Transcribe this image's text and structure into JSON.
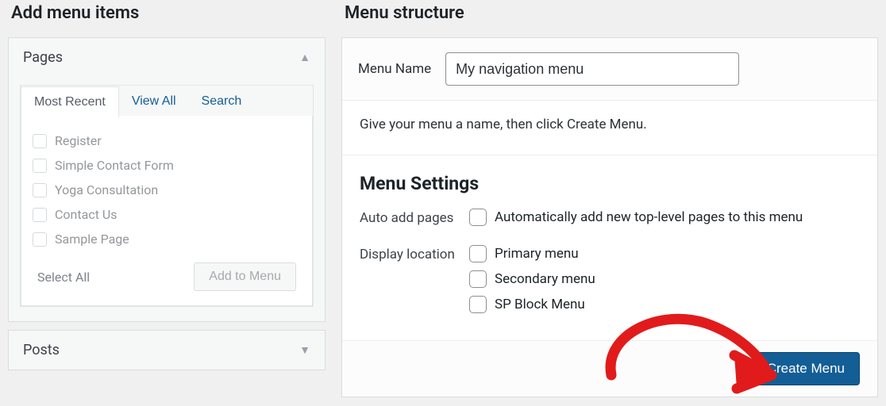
{
  "left": {
    "heading": "Add menu items",
    "panels": {
      "pages": {
        "title": "Pages",
        "tabs": [
          "Most Recent",
          "View All",
          "Search"
        ],
        "items": [
          "Register",
          "Simple Contact Form",
          "Yoga Consultation",
          "Contact Us",
          "Sample Page"
        ],
        "select_all": "Select All",
        "add_button": "Add to Menu"
      },
      "posts": {
        "title": "Posts"
      }
    }
  },
  "right": {
    "heading": "Menu structure",
    "menu_name_label": "Menu Name",
    "menu_name_value": "My navigation menu",
    "hint": "Give your menu a name, then click Create Menu.",
    "settings_title": "Menu Settings",
    "auto_add_label": "Auto add pages",
    "auto_add_option": "Automatically add new top-level pages to this menu",
    "display_location_label": "Display location",
    "locations": [
      "Primary menu",
      "Secondary menu",
      "SP Block Menu"
    ],
    "create_button": "Create Menu"
  },
  "annotation": {
    "color": "#e11b1b"
  }
}
